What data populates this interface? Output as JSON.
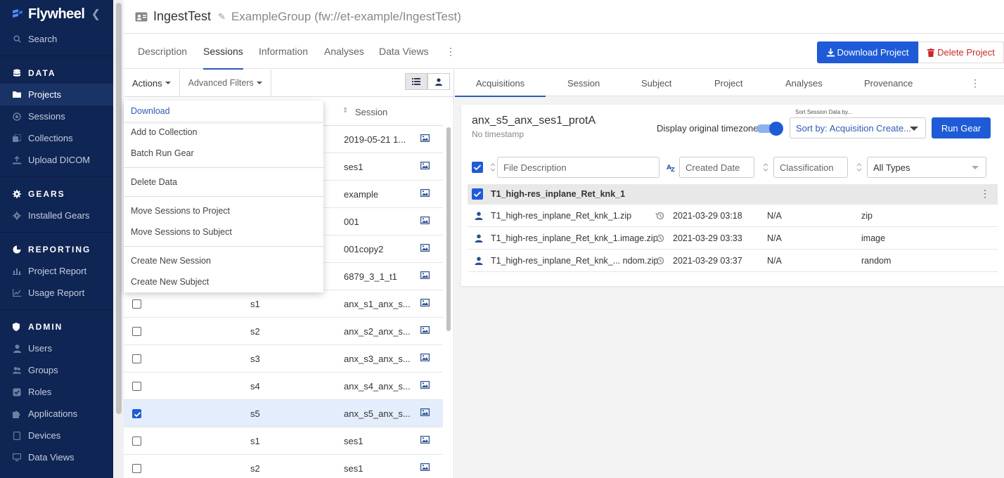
{
  "sidebar": {
    "brand": "Flywheel",
    "items": [
      {
        "label": "Search",
        "type": "item",
        "icon": "search-icon"
      },
      {
        "label": "DATA",
        "type": "section",
        "icon": "database-icon"
      },
      {
        "label": "Projects",
        "type": "item",
        "icon": "folder-icon",
        "active": true
      },
      {
        "label": "Sessions",
        "type": "item",
        "icon": "sessions-icon"
      },
      {
        "label": "Collections",
        "type": "item",
        "icon": "collections-icon"
      },
      {
        "label": "Upload DICOM",
        "type": "item",
        "icon": "upload-icon"
      },
      {
        "label": "GEARS",
        "type": "section",
        "icon": "gear-icon"
      },
      {
        "label": "Installed Gears",
        "type": "item",
        "icon": "gear-small-icon"
      },
      {
        "label": "REPORTING",
        "type": "section",
        "icon": "pie-chart-icon"
      },
      {
        "label": "Project Report",
        "type": "item",
        "icon": "bar-chart-icon"
      },
      {
        "label": "Usage Report",
        "type": "item",
        "icon": "line-chart-icon"
      },
      {
        "label": "ADMIN",
        "type": "section",
        "icon": "shield-icon"
      },
      {
        "label": "Users",
        "type": "item",
        "icon": "user-icon"
      },
      {
        "label": "Groups",
        "type": "item",
        "icon": "users-icon"
      },
      {
        "label": "Roles",
        "type": "item",
        "icon": "check-square-icon"
      },
      {
        "label": "Applications",
        "type": "item",
        "icon": "puzzle-icon"
      },
      {
        "label": "Devices",
        "type": "item",
        "icon": "device-icon"
      },
      {
        "label": "Data Views",
        "type": "item",
        "icon": "monitor-icon"
      }
    ]
  },
  "header": {
    "title": "IngestTest",
    "subtitle": "ExampleGroup (fw://et-example/IngestTest)"
  },
  "tabs": [
    {
      "label": "Description",
      "active": false
    },
    {
      "label": "Sessions",
      "active": true
    },
    {
      "label": "Information",
      "active": false
    },
    {
      "label": "Analyses",
      "active": false
    },
    {
      "label": "Data Views",
      "active": false
    }
  ],
  "buttons": {
    "download_project": "Download Project",
    "delete_project": "Delete Project"
  },
  "toolbar": {
    "actions": "Actions",
    "advanced_filters": "Advanced Filters"
  },
  "actions_menu": [
    {
      "label": "Download",
      "sep_after": false
    },
    {
      "label": "Add to Collection",
      "sep_after": false
    },
    {
      "label": "Batch Run Gear",
      "sep_after": true
    },
    {
      "label": "Delete Data",
      "sep_after": true
    },
    {
      "label": "Move Sessions to Project",
      "sep_after": false
    },
    {
      "label": "Move Sessions to Subject",
      "sep_after": true
    },
    {
      "label": "Create New Session",
      "sep_after": false
    },
    {
      "label": "Create New Subject",
      "sep_after": false
    }
  ],
  "sessions_table": {
    "session_header": "Session",
    "rows": [
      {
        "subject": "",
        "session": "2019-05-21 1...",
        "checked": false
      },
      {
        "subject": "",
        "session": "ses1",
        "checked": false
      },
      {
        "subject": "",
        "session": "example",
        "checked": false
      },
      {
        "subject": "",
        "session": "001",
        "checked": false
      },
      {
        "subject": "",
        "session": "001copy2",
        "checked": false
      },
      {
        "subject": "",
        "session": "6879_3_1_t1",
        "checked": false
      },
      {
        "subject": "s1",
        "session": "anx_s1_anx_s...",
        "checked": false
      },
      {
        "subject": "s2",
        "session": "anx_s2_anx_s...",
        "checked": false
      },
      {
        "subject": "s3",
        "session": "anx_s3_anx_s...",
        "checked": false
      },
      {
        "subject": "s4",
        "session": "anx_s4_anx_s...",
        "checked": false
      },
      {
        "subject": "s5",
        "session": "anx_s5_anx_s...",
        "checked": true
      },
      {
        "subject": "s1",
        "session": "ses1",
        "checked": false
      },
      {
        "subject": "s2",
        "session": "ses1",
        "checked": false
      }
    ]
  },
  "right_tabs": [
    {
      "label": "Acquisitions",
      "active": true
    },
    {
      "label": "Session",
      "active": false
    },
    {
      "label": "Subject",
      "active": false
    },
    {
      "label": "Project",
      "active": false
    },
    {
      "label": "Analyses",
      "active": false
    },
    {
      "label": "Provenance",
      "active": false
    }
  ],
  "session_card": {
    "name": "anx_s5_anx_ses1_protA",
    "timestamp": "No timestamp",
    "timezone_label": "Display original timezone",
    "sort_label": "Sort Session Data by...",
    "sort_value": "Sort by: Acquisition Create...",
    "run_gear": "Run Gear"
  },
  "filters": {
    "file_description": "File Description",
    "created_date": "Created Date",
    "classification": "Classification",
    "type": "All Types"
  },
  "acquisition": {
    "name": "T1_high-res_inplane_Ret_knk_1",
    "files": [
      {
        "name": "T1_high-res_inplane_Ret_knk_1.zip",
        "date": "2021-03-29 03:18",
        "classification": "N/A",
        "type": "zip"
      },
      {
        "name": "T1_high-res_inplane_Ret_knk_1.image.zip",
        "date": "2021-03-29 03:33",
        "classification": "N/A",
        "type": "image"
      },
      {
        "name": "T1_high-res_inplane_Ret_knk_... ndom.zip",
        "date": "2021-03-29 03:37",
        "classification": "N/A",
        "type": "random"
      }
    ]
  },
  "colors": {
    "sidebar_bg": "#0f2553",
    "primary": "#1f5bd7",
    "danger": "#c92828",
    "selected_row": "#e3edfb"
  }
}
